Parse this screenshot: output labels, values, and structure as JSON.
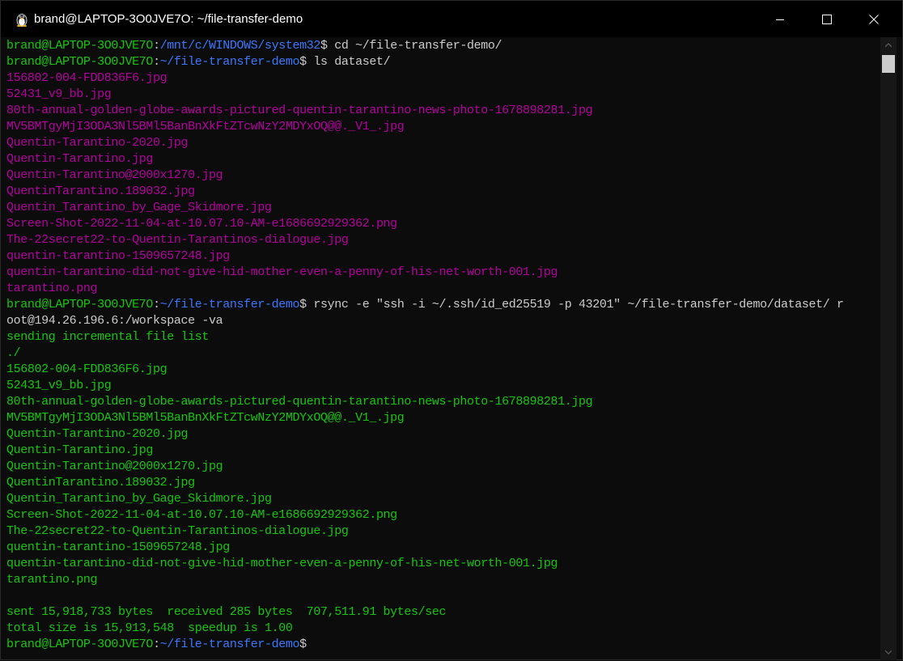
{
  "window": {
    "title": "brand@LAPTOP-3O0JVE7O: ~/file-transfer-demo",
    "icon": "tux-linux-icon",
    "controls": [
      "minimize",
      "maximize",
      "close"
    ]
  },
  "prompt": {
    "user_host": "brand@LAPTOP-3O0JVE7O",
    "colors": {
      "user_host": "#16c60c",
      "path": "#3b78ff",
      "text": "#cccccc",
      "image_file": "#b4009e",
      "rsync_output": "#16c60c"
    }
  },
  "commands": [
    {
      "path": "/mnt/c/WINDOWS/system32",
      "command": " cd ~/file-transfer-demo/"
    },
    {
      "path": "~/file-transfer-demo",
      "command": " ls dataset/"
    },
    {
      "path": "~/file-transfer-demo",
      "command": " rsync -e \"ssh -i ~/.ssh/id_ed25519 -p 43201\" ~/file-transfer-demo/dataset/ r"
    },
    {
      "path": "~/file-transfer-demo",
      "command": ""
    }
  ],
  "ls_output": [
    "156802-004-FDD836F6.jpg",
    "52431_v9_bb.jpg",
    "80th-annual-golden-globe-awards-pictured-quentin-tarantino-news-photo-1678898281.jpg",
    "MV5BMTgyMjI3ODA3Nl5BMl5BanBnXkFtZTcwNzY2MDYxOQ@@._V1_.jpg",
    "Quentin-Tarantino-2020.jpg",
    "Quentin-Tarantino.jpg",
    "Quentin-Tarantino@2000x1270.jpg",
    "QuentinTarantino.189032.jpg",
    "Quentin_Tarantino_by_Gage_Skidmore.jpg",
    "Screen-Shot-2022-11-04-at-10.07.10-AM-e1686692929362.png",
    "The-22secret22-to-Quentin-Tarantinos-dialogue.jpg",
    "quentin-tarantino-1509657248.jpg",
    "quentin-tarantino-did-not-give-hid-mother-even-a-penny-of-his-net-worth-001.jpg",
    "tarantino.png"
  ],
  "rsync_wrap": "oot@194.26.196.6:/workspace -va",
  "rsync_header": [
    "sending incremental file list",
    "./"
  ],
  "rsync_files": [
    "156802-004-FDD836F6.jpg",
    "52431_v9_bb.jpg",
    "80th-annual-golden-globe-awards-pictured-quentin-tarantino-news-photo-1678898281.jpg",
    "MV5BMTgyMjI3ODA3Nl5BMl5BanBnXkFtZTcwNzY2MDYxOQ@@._V1_.jpg",
    "Quentin-Tarantino-2020.jpg",
    "Quentin-Tarantino.jpg",
    "Quentin-Tarantino@2000x1270.jpg",
    "QuentinTarantino.189032.jpg",
    "Quentin_Tarantino_by_Gage_Skidmore.jpg",
    "Screen-Shot-2022-11-04-at-10.07.10-AM-e1686692929362.png",
    "The-22secret22-to-Quentin-Tarantinos-dialogue.jpg",
    "quentin-tarantino-1509657248.jpg",
    "quentin-tarantino-did-not-give-hid-mother-even-a-penny-of-his-net-worth-001.jpg",
    "tarantino.png"
  ],
  "rsync_summary": [
    "sent 15,918,733 bytes  received 285 bytes  707,511.91 bytes/sec",
    "total size is 15,913,548  speedup is 1.00"
  ]
}
